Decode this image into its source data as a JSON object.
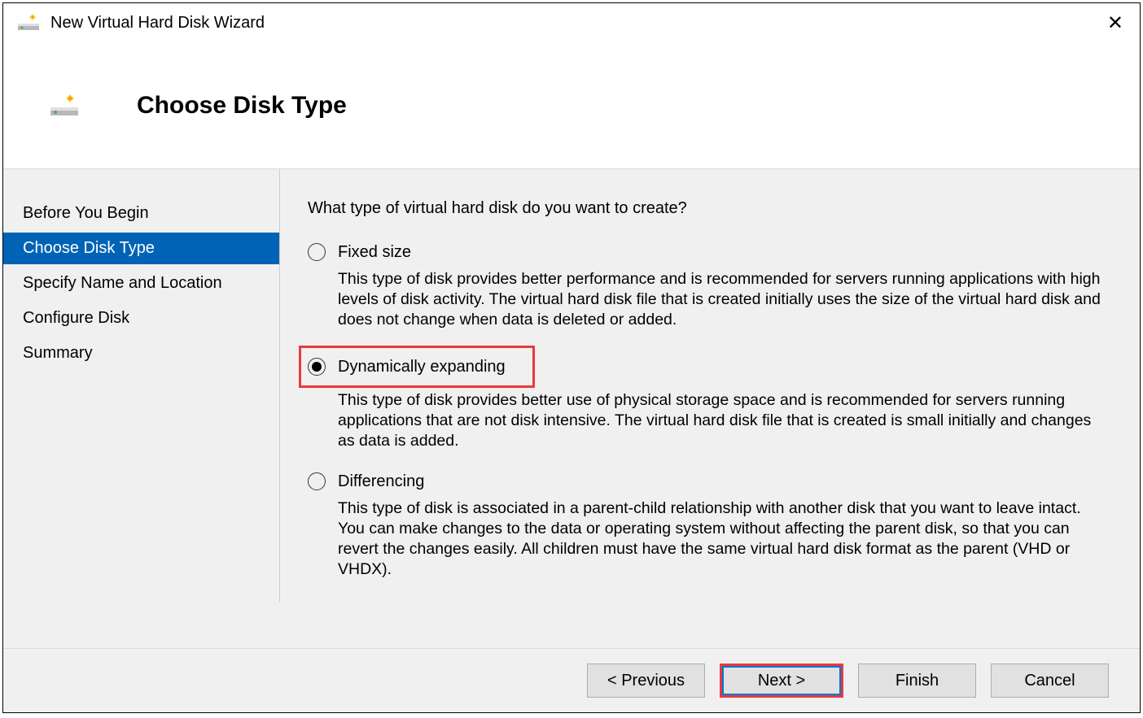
{
  "titlebar": {
    "title": "New Virtual Hard Disk Wizard"
  },
  "header": {
    "step_title": "Choose Disk Type"
  },
  "sidebar": {
    "items": [
      {
        "label": "Before You Begin",
        "selected": false
      },
      {
        "label": "Choose Disk Type",
        "selected": true
      },
      {
        "label": "Specify Name and Location",
        "selected": false
      },
      {
        "label": "Configure Disk",
        "selected": false
      },
      {
        "label": "Summary",
        "selected": false
      }
    ]
  },
  "main": {
    "question": "What type of virtual hard disk do you want to create?",
    "options": [
      {
        "label": "Fixed size",
        "checked": false,
        "highlighted": false,
        "description": "This type of disk provides better performance and is recommended for servers running applications with high levels of disk activity. The virtual hard disk file that is created initially uses the size of the virtual hard disk and does not change when data is deleted or added."
      },
      {
        "label": "Dynamically expanding",
        "checked": true,
        "highlighted": true,
        "description": "This type of disk provides better use of physical storage space and is recommended for servers running applications that are not disk intensive. The virtual hard disk file that is created is small initially and changes as data is added."
      },
      {
        "label": "Differencing",
        "checked": false,
        "highlighted": false,
        "description": "This type of disk is associated in a parent-child relationship with another disk that you want to leave intact. You can make changes to the data or operating system without affecting the parent disk, so that you can revert the changes easily. All children must have the same virtual hard disk format as the parent (VHD or VHDX)."
      }
    ]
  },
  "footer": {
    "previous": "< Previous",
    "next": "Next >",
    "finish": "Finish",
    "cancel": "Cancel"
  }
}
